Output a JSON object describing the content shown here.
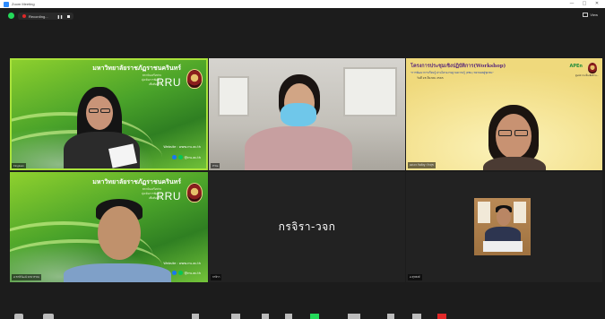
{
  "window": {
    "title": "Zoom Meeting",
    "min": "—",
    "max": "□",
    "close": "✕"
  },
  "topbar": {
    "recording_label": "Recording...",
    "pause_glyph": "❚❚",
    "view_label": "View"
  },
  "tiles": [
    {
      "id": "tile-1",
      "name_tag": "Fingtuan",
      "slide": {
        "uni_name": "มหาวิทยาลัยราชภัฏราชนครินทร์",
        "sub_lines": [
          "สถาบันเครือข่าย",
          "มุ่งเน้นการพัฒนา",
          "เพื่อท้องถิ่น"
        ],
        "logo_text": "RRU",
        "website": "Website : www.rru.ac.th",
        "social": "@rru.ac.th"
      }
    },
    {
      "id": "tile-2",
      "name_tag": "P'Da"
    },
    {
      "id": "tile-3",
      "name_tag": "ผศ.ดร.กิตติญา จิรสุข",
      "slide": {
        "title": "โครงการประชุมเชิงปฏิบัติการ(Workshop)",
        "subtitle": "\"การพัฒนาการเรียนรู้ ผ่านโครงงานฐานความรู้ (PBL) ขยายผลสู่ชุมชน\"",
        "date": "วันที่ 28 มีนาคม 2565",
        "logo_text": "APEn",
        "right_text": "ศูนย์ความเป็นเลิศด้าน..."
      }
    },
    {
      "id": "tile-4",
      "name_tag": "อ.ชาติวัฒน์ ฉายวรรณ",
      "slide": {
        "uni_name": "มหาวิทยาลัยราชภัฏราชนครินทร์",
        "sub_lines": [
          "สถาบันเครือข่าย",
          "มุ่งเน้นการพัฒนา",
          "เพื่อท้องถิ่น"
        ],
        "logo_text": "RRU",
        "website": "Website : www.rru.ac.th",
        "social": "@rru.ac.th"
      }
    },
    {
      "id": "tile-5",
      "name_tag": "กรจิรา",
      "display_name": "กรจิรา-วจก"
    },
    {
      "id": "tile-6",
      "name_tag": "อ.สุรพงษ์"
    }
  ],
  "colors": {
    "active_speaker": "#a9e23b",
    "record": "#e02828",
    "shield": "#23d959"
  }
}
